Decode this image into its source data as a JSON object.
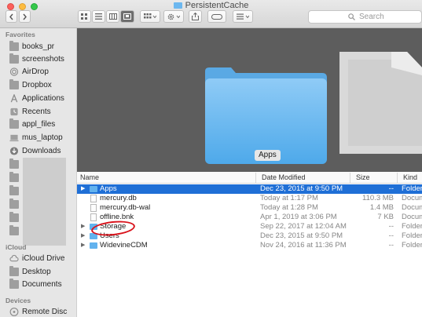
{
  "window": {
    "title": "PersistentCache"
  },
  "toolbar": {
    "search_placeholder": "Search",
    "back_icon": "chevron-left-icon",
    "forward_icon": "chevron-right-icon"
  },
  "sidebar": {
    "favorites_header": "Favorites",
    "favorites": [
      {
        "label": "books_pr",
        "icon": "folder-icon"
      },
      {
        "label": "screenshots",
        "icon": "folder-icon"
      },
      {
        "label": "AirDrop",
        "icon": "airdrop-icon"
      },
      {
        "label": "Dropbox",
        "icon": "dropbox-icon"
      },
      {
        "label": "Applications",
        "icon": "applications-icon"
      },
      {
        "label": "Recents",
        "icon": "recents-icon"
      },
      {
        "label": "appl_files",
        "icon": "folder-icon"
      },
      {
        "label": "mus_laptop",
        "icon": "computer-icon"
      },
      {
        "label": "Downloads",
        "icon": "downloads-icon"
      }
    ],
    "icloud_header": "iCloud",
    "icloud": [
      {
        "label": "iCloud Drive",
        "icon": "cloud-icon"
      },
      {
        "label": "Desktop",
        "icon": "desktop-icon"
      },
      {
        "label": "Documents",
        "icon": "documents-icon"
      }
    ],
    "devices_header": "Devices",
    "devices": [
      {
        "label": "Remote Disc",
        "icon": "disc-icon"
      }
    ]
  },
  "preview": {
    "label": "Apps"
  },
  "columns": {
    "name": "Name",
    "date": "Date Modified",
    "size": "Size",
    "kind": "Kind"
  },
  "rows": [
    {
      "name": "Apps",
      "date": "Dec 23, 2015 at 9:50 PM",
      "size": "--",
      "kind": "Folder",
      "type": "folder",
      "expandable": true,
      "selected": true
    },
    {
      "name": "mercury.db",
      "date": "Today at 1:17 PM",
      "size": "110.3 MB",
      "kind": "Docum",
      "type": "doc",
      "expandable": false,
      "selected": false
    },
    {
      "name": "mercury.db-wal",
      "date": "Today at 1:28 PM",
      "size": "1.4 MB",
      "kind": "Docum",
      "type": "doc",
      "expandable": false,
      "selected": false
    },
    {
      "name": "offline.bnk",
      "date": "Apr 1, 2019 at 3:06 PM",
      "size": "7 KB",
      "kind": "Docum",
      "type": "doc",
      "expandable": false,
      "selected": false
    },
    {
      "name": "Storage",
      "date": "Sep 22, 2017 at 12:04 AM",
      "size": "--",
      "kind": "Folder",
      "type": "folder",
      "expandable": true,
      "selected": false
    },
    {
      "name": "Users",
      "date": "Dec 23, 2015 at 9:50 PM",
      "size": "--",
      "kind": "Folder",
      "type": "folder",
      "expandable": true,
      "selected": false
    },
    {
      "name": "WidevineCDM",
      "date": "Nov 24, 2016 at 11:36 PM",
      "size": "--",
      "kind": "Folder",
      "type": "folder",
      "expandable": true,
      "selected": false
    }
  ],
  "colors": {
    "selection": "#1f6fd6",
    "folder": "#62b2ee",
    "annotation": "#d9121b",
    "preview_bg": "#5d5d5d"
  }
}
